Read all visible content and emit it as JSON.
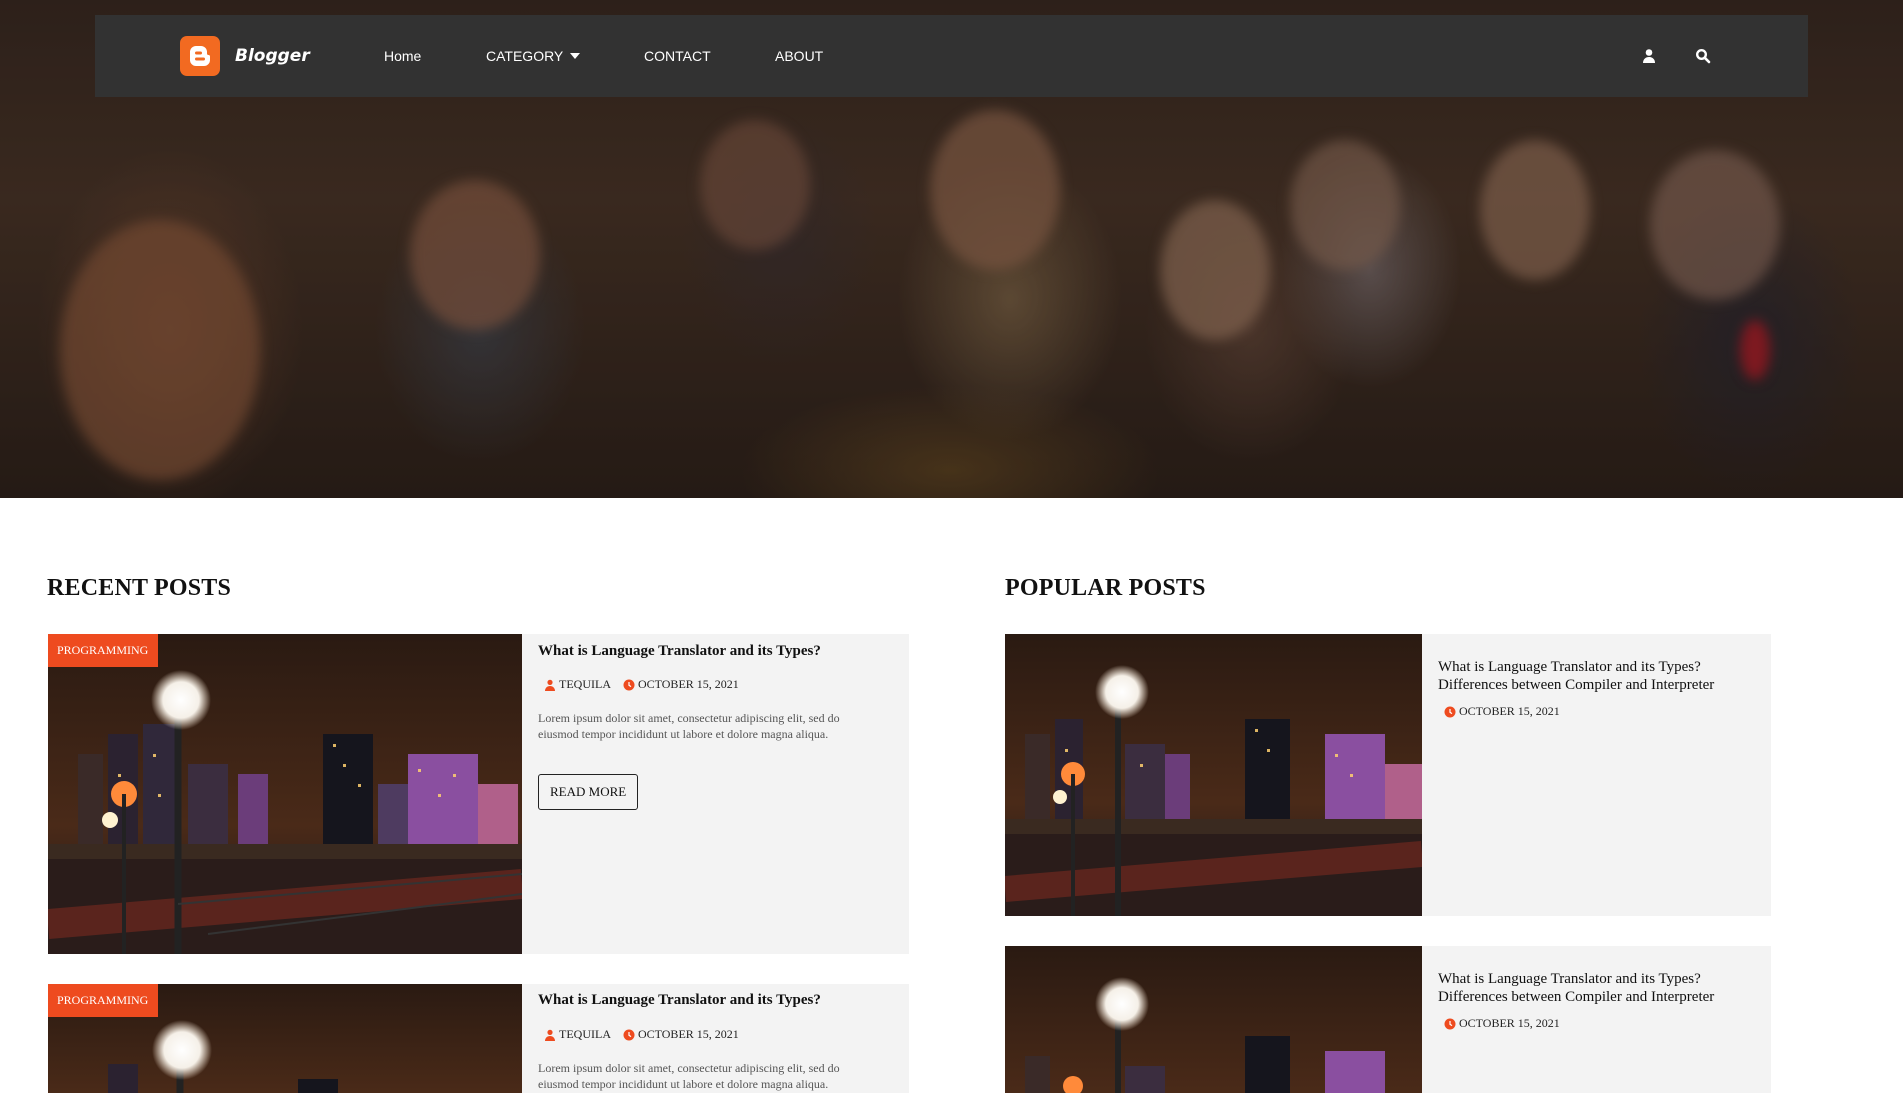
{
  "nav": {
    "brand": "Blogger",
    "links": [
      {
        "label": "Home"
      },
      {
        "label": "CATEGORY"
      },
      {
        "label": "CONTACT"
      },
      {
        "label": "ABOUT"
      }
    ],
    "icons": [
      "user-icon",
      "search-icon"
    ]
  },
  "colors": {
    "accent": "#ee4b1f",
    "navbar": "#323232",
    "card": "#f3f3f3",
    "logo": "#f26a21"
  },
  "recent": {
    "title": "RECENT POSTS",
    "posts": [
      {
        "category": "PROGRAMMING",
        "title": "What is Language Translator and its Types?",
        "author": "TEQUILA",
        "date": "OCTOBER 15, 2021",
        "excerpt_line1": "Lorem ipsum dolor sit amet, consectetur adipiscing elit, sed do",
        "excerpt_line2": "eiusmod tempor incididunt ut labore et dolore magna aliqua.",
        "button": "READ MORE"
      },
      {
        "category": "PROGRAMMING",
        "title": "What is Language Translator and its Types?",
        "author": "TEQUILA",
        "date": "OCTOBER 15, 2021",
        "excerpt_line1": "Lorem ipsum dolor sit amet, consectetur adipiscing elit, sed do",
        "excerpt_line2": "eiusmod tempor incididunt ut labore et dolore magna aliqua."
      }
    ]
  },
  "popular": {
    "title": "POPULAR POSTS",
    "posts": [
      {
        "title_line1": "What is Language Translator and its Types?",
        "title_line2": "Differences between Compiler and Interpreter",
        "date": "OCTOBER 15, 2021"
      },
      {
        "title_line1": "What is Language Translator and its Types?",
        "title_line2": "Differences between Compiler and Interpreter",
        "date": "OCTOBER 15, 2021"
      }
    ]
  }
}
